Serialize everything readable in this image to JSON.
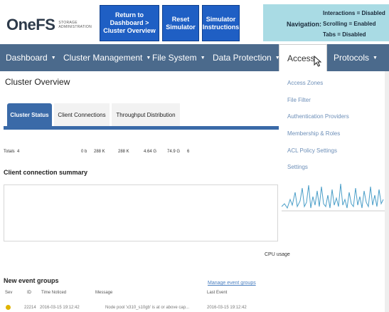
{
  "logo": {
    "main": "OneFS",
    "sub": "STORAGE ADMINISTRATION"
  },
  "top_buttons": {
    "dashboard": "Return to Dashboard > Cluster Overview",
    "reset": "Reset Simulator",
    "instructions": "Simulator Instructions"
  },
  "navigation": {
    "label": "Navigation:",
    "interactions": "Interactions = Disabled",
    "scrolling": "Scrolling = Enabled",
    "tabs": "Tabs = Disabled",
    "bg_color": "#a9dbe4"
  },
  "menu": {
    "dashboard": "Dashboard",
    "cluster": "Cluster Management",
    "file_system": "File System",
    "data_protection": "Data Protection",
    "access": "Access",
    "protocols": "Protocols",
    "bar_color": "#4b6a8c"
  },
  "access_dropdown": [
    "Access Zones",
    "File Filter",
    "Authentication Providers",
    "Membership & Roles",
    "ACL Policy Settings",
    "Settings"
  ],
  "page_title": "Cluster Overview",
  "tabs": {
    "status": "Cluster Status",
    "connections": "Client Connections",
    "throughput": "Throughput Distribution"
  },
  "totals": {
    "label": "Totals",
    "count": "4",
    "v1": "0 b",
    "v2": "288 K",
    "v3": "288 K",
    "v4": "4.64 G",
    "v5": "74.9 G",
    "v6": "6"
  },
  "client_summary": {
    "title": "Client connection summary"
  },
  "cpu": {
    "label": "CPU usage"
  },
  "events": {
    "title": "New event groups",
    "manage_link": "Manage event groups",
    "headers": {
      "sev": "Sev",
      "id": "ID",
      "time": "Time Noticed",
      "message": "Message",
      "last": "Last Event"
    },
    "row": {
      "id": "22214",
      "time": "2016-03-15 19:12:42",
      "message": "Node pool 'x310_s10gb' is at or above cap...",
      "last": "2016-03-15 19:12:42"
    }
  }
}
